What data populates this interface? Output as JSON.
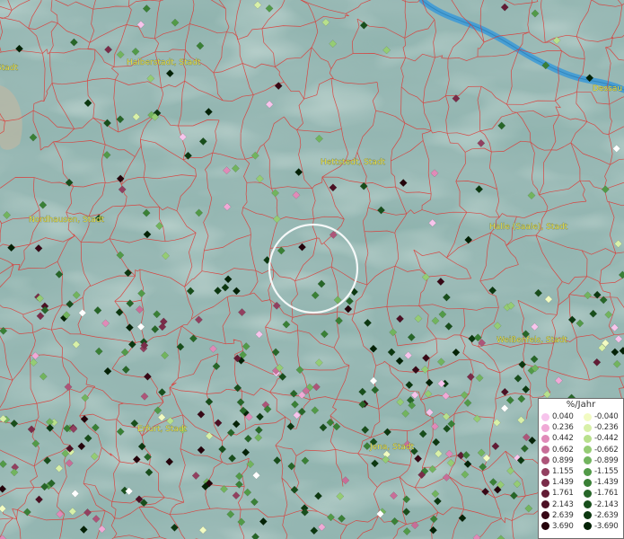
{
  "cities": [
    {
      "id": "halberstadt",
      "label": "Halberstadt, Stadt"
    },
    {
      "id": "hettstedt",
      "label": "Hettstedt, Stadt"
    },
    {
      "id": "nordhausen",
      "label": "Nordhausen, Stadt"
    },
    {
      "id": "halle",
      "label": "Halle (Saale), Stadt"
    },
    {
      "id": "weissenfels",
      "label": "Weißenfels, Stadt"
    },
    {
      "id": "erfurt",
      "label": "Erfurt, Stadt"
    },
    {
      "id": "jena",
      "label": "Jena, Stadt"
    },
    {
      "id": "dessau",
      "label": "Dessau"
    },
    {
      "id": "edge_left",
      "label": "Stadt"
    }
  ],
  "legend": {
    "title": "%/Jahr",
    "positive": [
      {
        "value": "0.040",
        "color": "#f7c4ec"
      },
      {
        "value": "0.236",
        "color": "#f0a9d6"
      },
      {
        "value": "0.442",
        "color": "#e08ab8"
      },
      {
        "value": "0.662",
        "color": "#c86e98"
      },
      {
        "value": "0.899",
        "color": "#ad5579"
      },
      {
        "value": "1.155",
        "color": "#924060"
      },
      {
        "value": "1.439",
        "color": "#7a2c49"
      },
      {
        "value": "1.761",
        "color": "#621c35"
      },
      {
        "value": "2.143",
        "color": "#4c1024"
      },
      {
        "value": "2.639",
        "color": "#380816"
      },
      {
        "value": "3.690",
        "color": "#25030b"
      }
    ],
    "negative": [
      {
        "value": "-0.040",
        "color": "#f2fbc2"
      },
      {
        "value": "-0.236",
        "color": "#d8f0a8"
      },
      {
        "value": "-0.442",
        "color": "#b8e08c"
      },
      {
        "value": "-0.662",
        "color": "#95cc74"
      },
      {
        "value": "-0.899",
        "color": "#72b45e"
      },
      {
        "value": "-1.155",
        "color": "#529a48"
      },
      {
        "value": "-1.439",
        "color": "#3a8036"
      },
      {
        "value": "-1.761",
        "color": "#276628"
      },
      {
        "value": "-2.143",
        "color": "#184e1b"
      },
      {
        "value": "-2.639",
        "color": "#0c3810"
      },
      {
        "value": "-3.690",
        "color": "#042206"
      }
    ]
  },
  "colors": {
    "terrain": "#8fb3ae",
    "boundary": "#e0332f",
    "river": "#3f9bd6",
    "highlight_ring": "#ffffff",
    "city_label": "#e8e04a"
  },
  "stations_seed": 7341,
  "stations_count": 420
}
